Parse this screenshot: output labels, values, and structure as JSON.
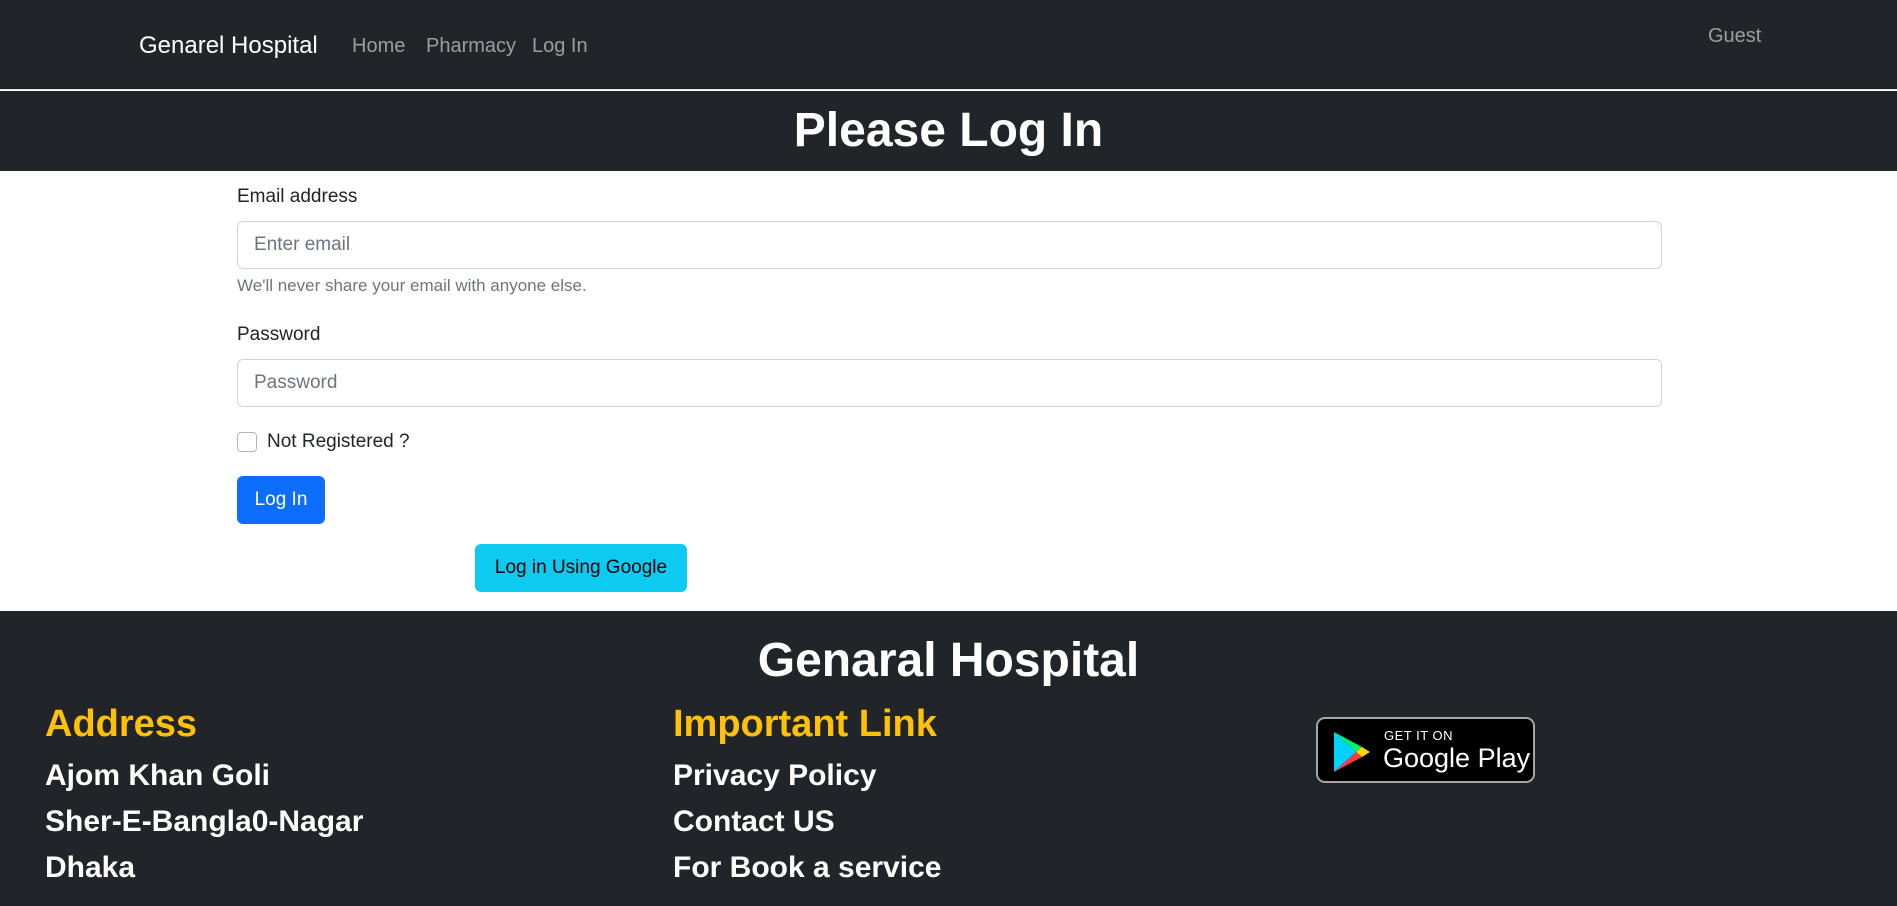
{
  "navbar": {
    "brand": "Genarel Hospital",
    "links": [
      "Home",
      "Pharmacy",
      "Log In"
    ],
    "user": "Guest"
  },
  "banner": {
    "title": "Please Log In"
  },
  "form": {
    "email_label": "Email address",
    "email_placeholder": "Enter email",
    "email_help": "We'll never share your email with anyone else.",
    "password_label": "Password",
    "password_placeholder": "Password",
    "checkbox_label": "Not Registered ?",
    "login_button": "Log In",
    "google_button": "Log in Using Google"
  },
  "footer": {
    "title": "Genaral Hospital",
    "address_heading": "Address",
    "address_lines": [
      "Ajom Khan Goli",
      "Sher-E-Bangla0-Nagar",
      "Dhaka"
    ],
    "links_heading": "Important Link",
    "links": [
      "Privacy Policy",
      "Contact US",
      "For Book a service"
    ],
    "badge": {
      "small": "GET IT ON",
      "big": "Google Play",
      "icon": "google-play-icon"
    }
  },
  "colors": {
    "dark": "#212529",
    "primary": "#0d6efd",
    "info": "#0dcaf0",
    "warning": "#ffc107"
  }
}
